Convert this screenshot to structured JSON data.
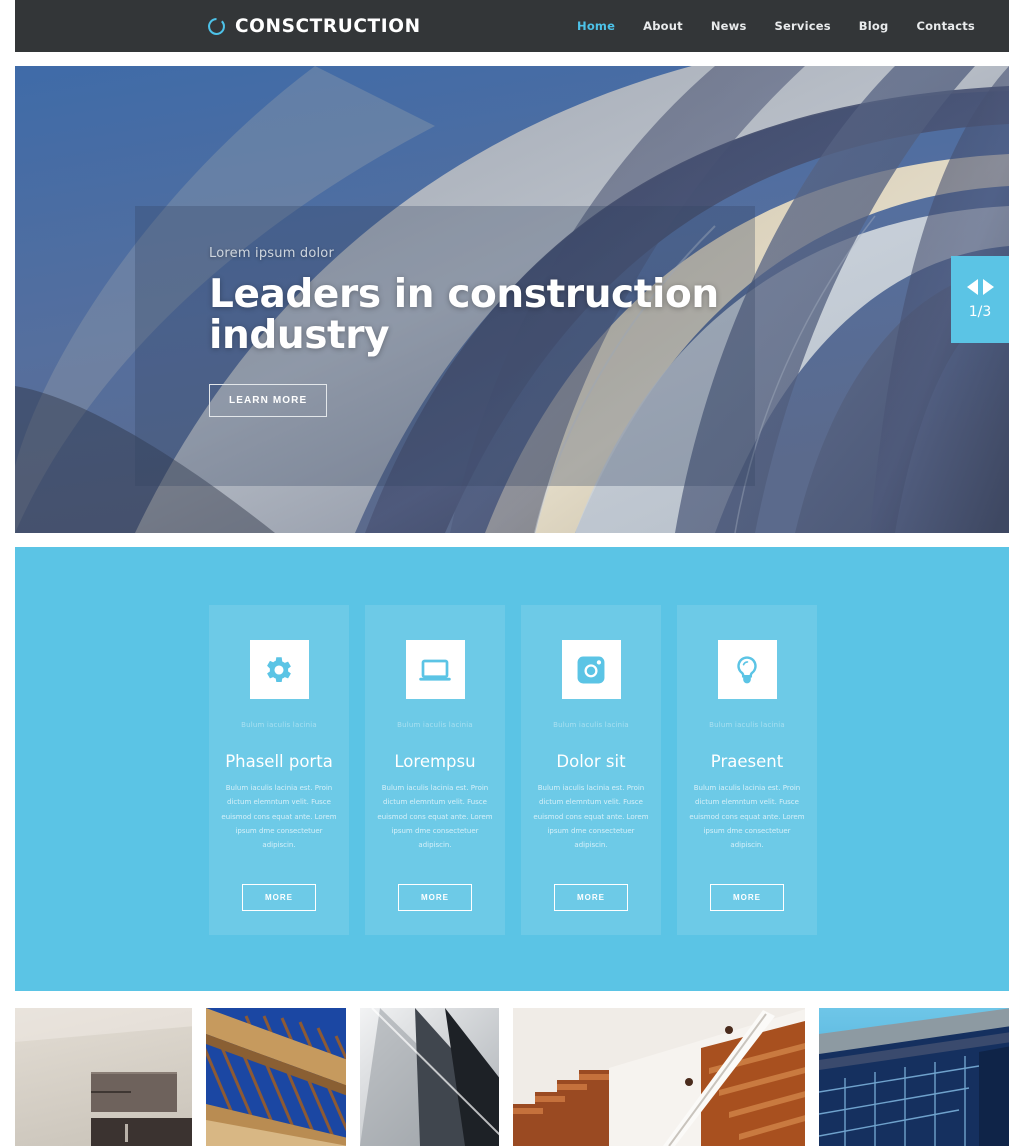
{
  "header": {
    "brand": {
      "icon": "ring-logo-icon",
      "text": "CONSCTRUCTION"
    },
    "nav": [
      {
        "label": "Home",
        "active": true
      },
      {
        "label": "About",
        "active": false
      },
      {
        "label": "News",
        "active": false
      },
      {
        "label": "Services",
        "active": false
      },
      {
        "label": "Blog",
        "active": false
      },
      {
        "label": "Contacts",
        "active": false
      }
    ],
    "bg_color": "#333638",
    "accent_color": "#4dc2e8"
  },
  "hero": {
    "kicker": "Lorem ipsum dolor",
    "title": "Leaders in construction industry",
    "button_label": "LEARN MORE",
    "slider": {
      "counter": "1/3",
      "prev_icon": "arrow-left-icon",
      "next_icon": "arrow-right-icon",
      "bg_color": "#5bc4e5"
    }
  },
  "services": {
    "bg_color": "#5bc4e5",
    "cards": [
      {
        "icon": "gear-icon",
        "caption": "Bulum iaculis lacinia",
        "title": "Phasell porta",
        "text": "Bulum iaculis lacinia est. Proin dictum elemntum velit. Fusce euismod cons equat ante. Lorem ipsum dme consectetuer adipiscin.",
        "button_label": "MORE"
      },
      {
        "icon": "laptop-icon",
        "caption": "Bulum iaculis lacinia",
        "title": "Lorempsu",
        "text": "Bulum iaculis lacinia est. Proin dictum elemntum velit. Fusce euismod cons equat ante. Lorem ipsum dme consectetuer adipiscin.",
        "button_label": "MORE"
      },
      {
        "icon": "camera-icon",
        "caption": "Bulum iaculis lacinia",
        "title": "Dolor sit",
        "text": "Bulum iaculis lacinia est. Proin dictum elemntum velit. Fusce euismod cons equat ante. Lorem ipsum dme consectetuer adipiscin.",
        "button_label": "MORE"
      },
      {
        "icon": "lightbulb-icon",
        "caption": "Bulum iaculis lacinia",
        "title": "Praesent",
        "text": "Bulum iaculis lacinia est. Proin dictum elemntum velit. Fusce euismod cons equat ante. Lorem ipsum dme consectetuer adipiscin.",
        "button_label": "MORE"
      }
    ]
  },
  "gallery": {
    "items": [
      {
        "name": "interior-shelving-photo"
      },
      {
        "name": "blue-timber-roof-photo"
      },
      {
        "name": "white-ceiling-angle-photo"
      },
      {
        "name": "wooden-staircase-photo"
      },
      {
        "name": "blue-glass-facade-photo"
      }
    ]
  }
}
